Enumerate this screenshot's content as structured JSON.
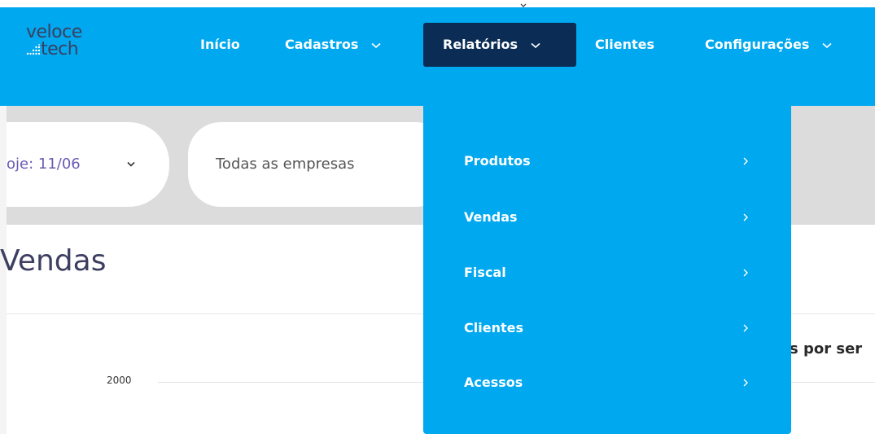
{
  "logo": {
    "line1": "veloce",
    "line2": "tech"
  },
  "nav": {
    "items": [
      {
        "label": "Início"
      },
      {
        "label": "Cadastros"
      },
      {
        "label": "Relatórios"
      },
      {
        "label": "Clientes"
      },
      {
        "label": "Configurações"
      }
    ]
  },
  "filters": {
    "date_value": "oje: 11/06",
    "company_value": "Todas as empresas"
  },
  "page": {
    "title": "Vendas"
  },
  "chart": {
    "y_tick": "2000",
    "title_fragment": "s por ser"
  },
  "dropdown": {
    "items": [
      {
        "label": "Produtos"
      },
      {
        "label": "Vendas"
      },
      {
        "label": "Fiscal"
      },
      {
        "label": "Clientes"
      },
      {
        "label": "Acessos"
      }
    ]
  },
  "colors": {
    "accent": "#00a8ef",
    "active_nav": "#0b2d55",
    "logo_text": "#3c3f61"
  }
}
